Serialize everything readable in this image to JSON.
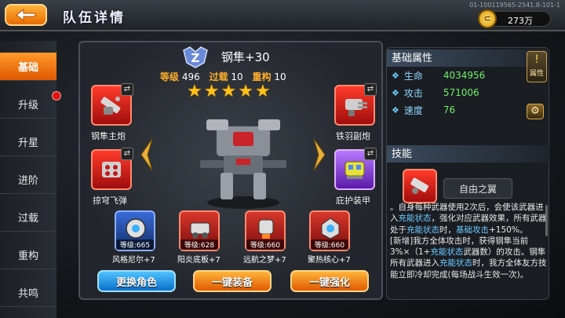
{
  "header": {
    "title": "队伍详情",
    "server_id": "01-100119565-2541.8-101-1",
    "currency": "273万"
  },
  "sidebar": {
    "items": [
      {
        "label": "基础",
        "active": true
      },
      {
        "label": "升级",
        "active": false,
        "badge": true
      },
      {
        "label": "升星",
        "active": false
      },
      {
        "label": "进阶",
        "active": false
      },
      {
        "label": "过载",
        "active": false
      },
      {
        "label": "重构",
        "active": false
      },
      {
        "label": "共鸣",
        "active": false
      }
    ]
  },
  "character": {
    "rank_badge": "Z",
    "name": "钢隼+30",
    "stats": [
      {
        "label": "等级",
        "value": "496"
      },
      {
        "label": "过载",
        "value": "10"
      },
      {
        "label": "重构",
        "value": "10"
      }
    ],
    "stars": 5
  },
  "equipment": [
    {
      "label": "钢隼主炮",
      "icon": "cannon-icon"
    },
    {
      "label": "铁羽副炮",
      "icon": "gatling-icon"
    },
    {
      "label": "掠穹飞弹",
      "icon": "missile-icon"
    },
    {
      "label": "庇护装甲",
      "icon": "armor-icon"
    }
  ],
  "support": [
    {
      "label": "风格尼尔+7",
      "level": "等级:665"
    },
    {
      "label": "阳炎底板+7",
      "level": "等级:628"
    },
    {
      "label": "远航之梦+7",
      "level": "等级:660"
    },
    {
      "label": "聚热核心+7",
      "level": "等级:660"
    }
  ],
  "buttons": {
    "change_role": "更换角色",
    "equip_all": "一键装备",
    "enhance_all": "一键强化"
  },
  "attributes": {
    "section_title": "基础属性",
    "attr_button": "属性",
    "rows": [
      {
        "name": "生命",
        "value": "4034956"
      },
      {
        "name": "攻击",
        "value": "571006"
      },
      {
        "name": "速度",
        "value": "76"
      }
    ]
  },
  "skill": {
    "section_title": "技能",
    "name": "自由之翼",
    "desc_1": "。自身每种武器使用2次后，会使该武器进入",
    "desc_hl_1": "充能状态",
    "desc_2": "，强化对应武器效果，所有武器处于",
    "desc_hl_2": "充能状态",
    "desc_3": "时，",
    "desc_hl_3": "基础攻击",
    "desc_4": "+150%。",
    "desc_5": "[新增]我方全体攻击时，获得钢隼当前3%×（1+",
    "desc_hl_4": "充能状态",
    "desc_6": "武器数）的攻击。钢隼所有武器进入",
    "desc_hl_5": "充能状态",
    "desc_7": "时，我方全体友方技能立即冷却完成(每场战斗生效一次)。"
  },
  "colors": {
    "accent_orange": "#ff9a2a",
    "button_blue": "#0b6fc8",
    "value_green": "#6ef06a",
    "label_gold": "#ffb02a"
  }
}
